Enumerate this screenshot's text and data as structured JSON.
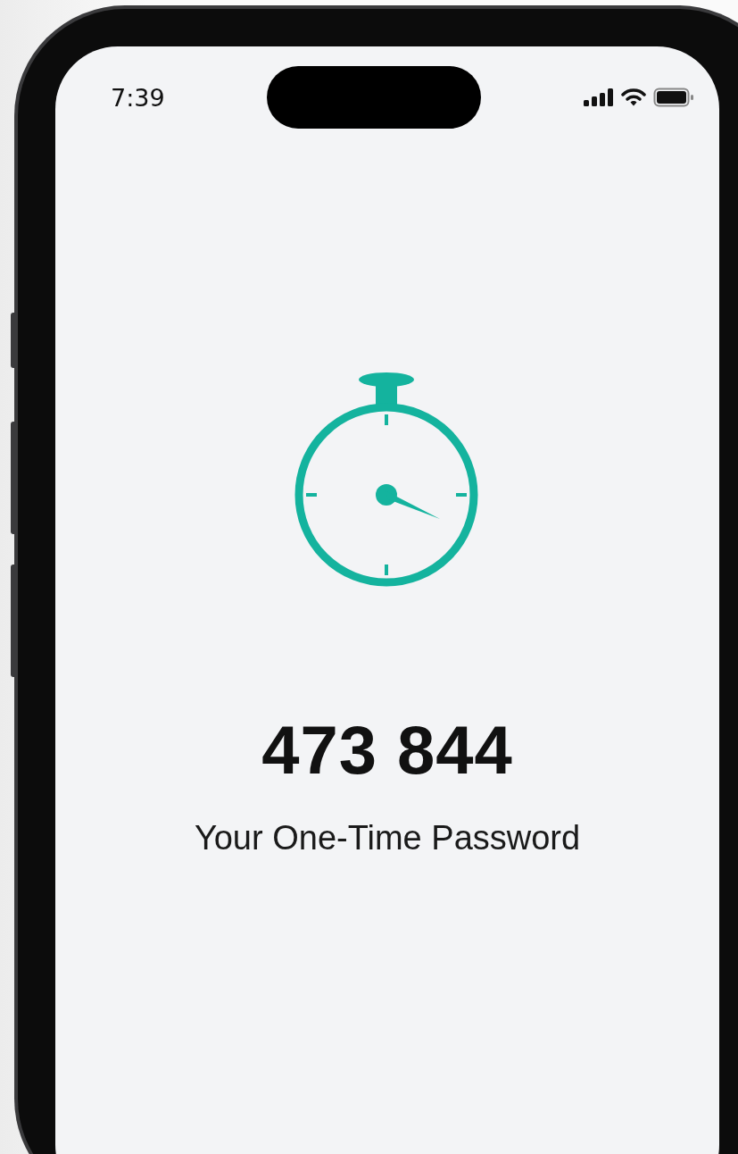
{
  "status_bar": {
    "time": "7:39"
  },
  "otp": {
    "code": "473 844",
    "caption": "Your One-Time Password"
  }
}
